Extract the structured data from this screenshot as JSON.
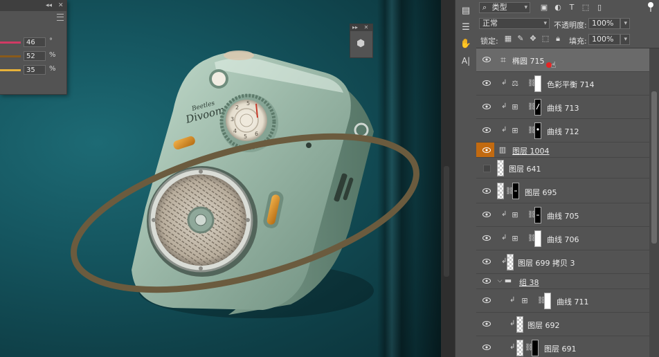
{
  "colors": {
    "canvas_teal": "#0f4149",
    "ring_brown": "#6b5b3e",
    "device_mint": "#9bb8a8",
    "panel_gray": "#535353",
    "selected_row": "#6a6a6a",
    "visibility_orange": "#c26a10",
    "swatch_magenta": "#d13a64",
    "swatch_brown": "#8a5a1a",
    "swatch_yellow": "#e6b23a"
  },
  "adjust_panel": {
    "collapse_glyph": "◂◂",
    "close_glyph": "✕",
    "rows": [
      {
        "value": "46",
        "unit": "°"
      },
      {
        "value": "52",
        "unit": "%"
      },
      {
        "value": "35",
        "unit": "%"
      }
    ]
  },
  "mini_box": {
    "collapse_glyph": "▸▸",
    "close_glyph": "✕"
  },
  "device": {
    "brand_top": "Beetles",
    "brand_main": "Divoom",
    "dial_numbers": [
      "2",
      "5",
      "3",
      "4",
      "5",
      "6"
    ]
  },
  "tools": [
    {
      "name": "swatches-tool-icon",
      "glyph": "▤"
    },
    {
      "name": "adjustments-tool-icon",
      "glyph": "☰"
    },
    {
      "name": "puppet-tool-icon",
      "glyph": "✋"
    },
    {
      "name": "character-tool-icon",
      "glyph": "A|"
    }
  ],
  "layers_panel": {
    "filter_label": "类型",
    "filter_icon": "⌕",
    "blend_mode": "正常",
    "opacity_label": "不透明度:",
    "opacity_value": "100%",
    "lock_label": "锁定:",
    "fill_label": "填充:",
    "fill_value": "100%",
    "layers": [
      {
        "name": "椭圆 715",
        "kind": "shape",
        "visible": true,
        "selected": true
      },
      {
        "name": "色彩平衡 714",
        "kind": "adjust-balance",
        "visible": true,
        "mask": "white",
        "clipped": true
      },
      {
        "name": "曲线 713",
        "kind": "adjust-curves",
        "visible": true,
        "mask": "black-slash",
        "clipped": true
      },
      {
        "name": "曲线 712",
        "kind": "adjust-curves",
        "visible": true,
        "mask": "black-dot",
        "clipped": true
      },
      {
        "name": "图层 1004",
        "kind": "smart",
        "visible": true,
        "orange": true,
        "underline": true
      },
      {
        "name": "图层 641",
        "kind": "pixel",
        "visible": false
      },
      {
        "name": "图层 695",
        "kind": "pixel-mask",
        "visible": true
      },
      {
        "name": "曲线 705",
        "kind": "adjust-curves",
        "visible": true,
        "mask": "black-dash",
        "clipped": true
      },
      {
        "name": "曲线 706",
        "kind": "adjust-curves",
        "visible": true,
        "mask": "white",
        "clipped": true
      },
      {
        "name": "图层 699 拷贝 3",
        "kind": "pixel-clip",
        "visible": true,
        "clipped": true
      },
      {
        "name": "组 38",
        "kind": "group",
        "visible": true,
        "underline": true
      },
      {
        "name": "曲线 711",
        "kind": "adjust-curves",
        "visible": true,
        "mask": "white",
        "clipped": true
      },
      {
        "name": "图层 692",
        "kind": "pixel-clip",
        "visible": true,
        "clipped": true
      },
      {
        "name": "图层 691",
        "kind": "pixel-clip-mask",
        "visible": true,
        "clipped": true
      }
    ]
  }
}
